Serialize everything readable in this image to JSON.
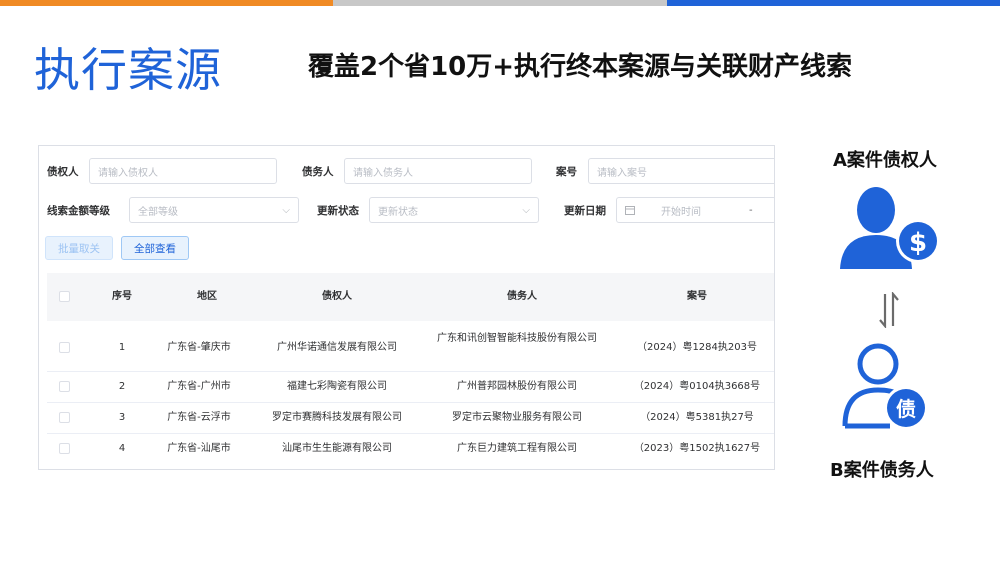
{
  "colors": {
    "bar_orange": "#f08a24",
    "bar_gray": "#c8c8c8",
    "bar_blue": "#1f63d8",
    "title_blue": "#1f63d8",
    "icon_blue": "#1f63d8"
  },
  "title": "执行案源",
  "subtitle": "覆盖2个省10万+执行终本案源与关联财产线索",
  "filters": {
    "creditor_label": "债权人",
    "creditor_placeholder": "请输入债权人",
    "debtor_label": "债务人",
    "debtor_placeholder": "请输入债务人",
    "case_label": "案号",
    "case_placeholder": "请输入案号",
    "amount_label": "线索金额等级",
    "amount_value": "全部等级",
    "status_label": "更新状态",
    "status_value": "更新状态",
    "date_label": "更新日期",
    "date_start": "开始时间",
    "date_sep": "-"
  },
  "buttons": {
    "batch_cancel": "批量取关",
    "view_all": "全部查看"
  },
  "table": {
    "headers": [
      "序号",
      "地区",
      "债权人",
      "债务人",
      "案号"
    ],
    "rows": [
      {
        "no": "1",
        "region": "广东省-肇庆市",
        "creditor": "广州华诺通信发展有限公司",
        "debtor": "广东和讯创智智能科技股份有限公司",
        "case": "（2024）粤1284执203号"
      },
      {
        "no": "2",
        "region": "广东省-广州市",
        "creditor": "福建七彩陶瓷有限公司",
        "debtor": "广州普邦园林股份有限公司",
        "case": "（2024）粤0104执3668号"
      },
      {
        "no": "3",
        "region": "广东省-云浮市",
        "creditor": "罗定市赛腾科技发展有限公司",
        "debtor": "罗定市云聚物业服务有限公司",
        "case": "（2024）粤5381执27号"
      },
      {
        "no": "4",
        "region": "广东省-汕尾市",
        "creditor": "汕尾市生生能源有限公司",
        "debtor": "广东巨力建筑工程有限公司",
        "case": "（2023）粤1502执1627号"
      }
    ]
  },
  "right": {
    "creditor_label": "A案件债权人",
    "debtor_label": "B案件债务人",
    "debt_char": "债",
    "dollar": "$"
  }
}
